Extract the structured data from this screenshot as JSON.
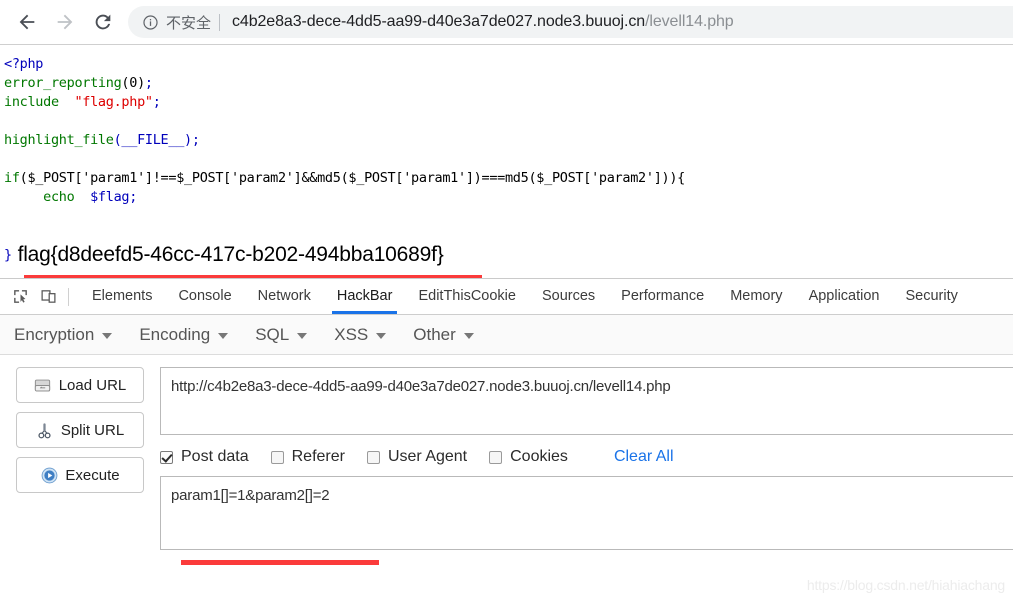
{
  "browser": {
    "back_label": "Back",
    "forward_label": "Forward",
    "reload_label": "Reload",
    "security_label": "不安全",
    "url_host": "c4b2e8a3-dece-4dd5-aa99-d40e3a7de027.node3.buuoj.cn",
    "url_path": "/levell14.php"
  },
  "page": {
    "php_code_line1": "<?php",
    "php_code": {
      "l1_tag": "<?php",
      "l2_fn": "error_reporting",
      "l2_args": "(0)",
      "l2_semi": ";",
      "l3_kw": "include",
      "l3_str": "\"flag.php\"",
      "l3_semi": ";",
      "l5_fn": "highlight_file",
      "l5_args": "(__FILE__)",
      "l5_semi": ";",
      "l7_if": "if",
      "l7_expr": "($_POST['param1']!==$_POST['param2']&&md5($_POST['param1'])===md5($_POST['param2'])){",
      "l8_echo": "echo",
      "l8_var": "$flag",
      "l8_semi": ";",
      "l9_brace": "}"
    },
    "flag_text": "flag{d8deefd5-46cc-417c-b202-494bba10689f}",
    "closing_brace": "}"
  },
  "devtools": {
    "inspect_icon_label": "Inspect element",
    "device_icon_label": "Toggle device toolbar",
    "tabs": [
      {
        "label": "Elements",
        "active": false
      },
      {
        "label": "Console",
        "active": false
      },
      {
        "label": "Network",
        "active": false
      },
      {
        "label": "HackBar",
        "active": true
      },
      {
        "label": "EditThisCookie",
        "active": false
      },
      {
        "label": "Sources",
        "active": false
      },
      {
        "label": "Performance",
        "active": false
      },
      {
        "label": "Memory",
        "active": false
      },
      {
        "label": "Application",
        "active": false
      },
      {
        "label": "Security",
        "active": false
      }
    ]
  },
  "hackbar": {
    "menus": [
      {
        "label": "Encryption"
      },
      {
        "label": "Encoding"
      },
      {
        "label": "SQL"
      },
      {
        "label": "XSS"
      },
      {
        "label": "Other"
      }
    ],
    "buttons": [
      {
        "label": "Load URL",
        "icon": "load-url-icon"
      },
      {
        "label": "Split URL",
        "icon": "scissors-icon"
      },
      {
        "label": "Execute",
        "icon": "play-icon"
      }
    ],
    "url_value": "http://c4b2e8a3-dece-4dd5-aa99-d40e3a7de027.node3.buuoj.cn/levell14.php",
    "url_placeholder": "",
    "options": [
      {
        "label": "Post data",
        "checked": true
      },
      {
        "label": "Referer",
        "checked": false
      },
      {
        "label": "User Agent",
        "checked": false
      },
      {
        "label": "Cookies",
        "checked": false
      }
    ],
    "clear_all_label": "Clear All",
    "post_data_value": "param1[]=1&param2[]=2",
    "post_data_placeholder": ""
  },
  "watermark": "https://blog.csdn.net/hiahiachang",
  "colors": {
    "accent_blue": "#1a73e8",
    "annotation_red": "#fb3b3b",
    "php_blue": "#0000bb",
    "php_green": "#007700",
    "php_red": "#dd0000"
  }
}
